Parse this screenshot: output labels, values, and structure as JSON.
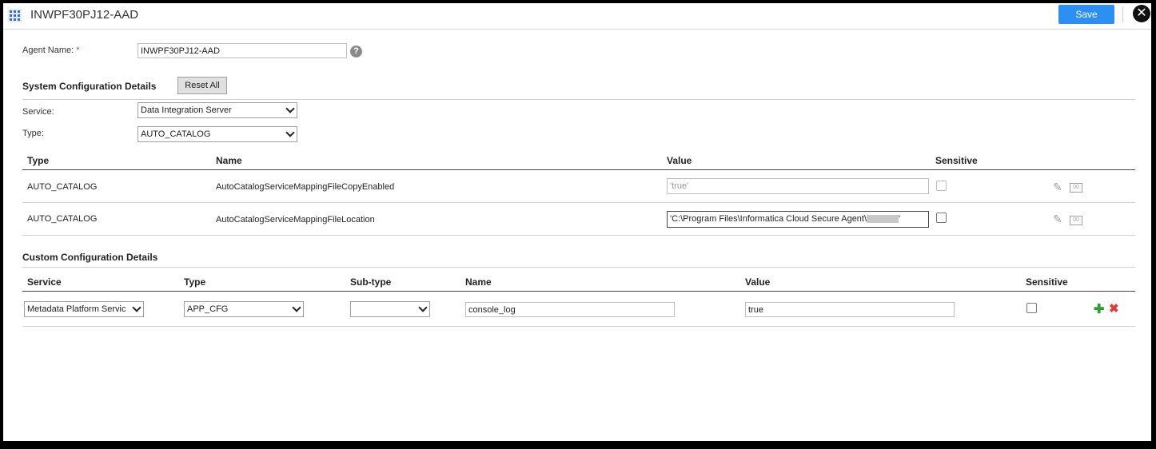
{
  "window": {
    "title": "INWPF30PJ12-AAD",
    "save_label": "Save",
    "close_icon": "close-icon"
  },
  "agent": {
    "label": "Agent Name:",
    "required_mark": "*",
    "value": "INWPF30PJ12-AAD"
  },
  "system_config": {
    "title": "System Configuration Details",
    "reset_label": "Reset All",
    "service_label": "Service:",
    "service_value": "Data Integration Server",
    "type_label": "Type:",
    "type_value": "AUTO_CATALOG",
    "columns": [
      "Type",
      "Name",
      "Value",
      "Sensitive"
    ],
    "rows": [
      {
        "type": "AUTO_CATALOG",
        "name": "AutoCatalogServiceMappingFileCopyEnabled",
        "value": "'true'",
        "sensitive": false
      },
      {
        "type": "AUTO_CATALOG",
        "name": "AutoCatalogServiceMappingFileLocation",
        "value": "'C:\\Program Files\\Informatica Cloud Secure Agent\\",
        "value_suffix": "'",
        "sensitive": false
      }
    ]
  },
  "custom_config": {
    "title": "Custom Configuration Details",
    "columns": [
      "Service",
      "Type",
      "Sub-type",
      "Name",
      "Value",
      "Sensitive"
    ],
    "row": {
      "service": "Metadata Platform Servic",
      "type": "APP_CFG",
      "subtype": "",
      "name": "console_log",
      "value": "true",
      "sensitive": false
    }
  },
  "colors": {
    "accent": "#2d8ef3",
    "add": "#2e9e2e",
    "delete": "#e53935"
  }
}
